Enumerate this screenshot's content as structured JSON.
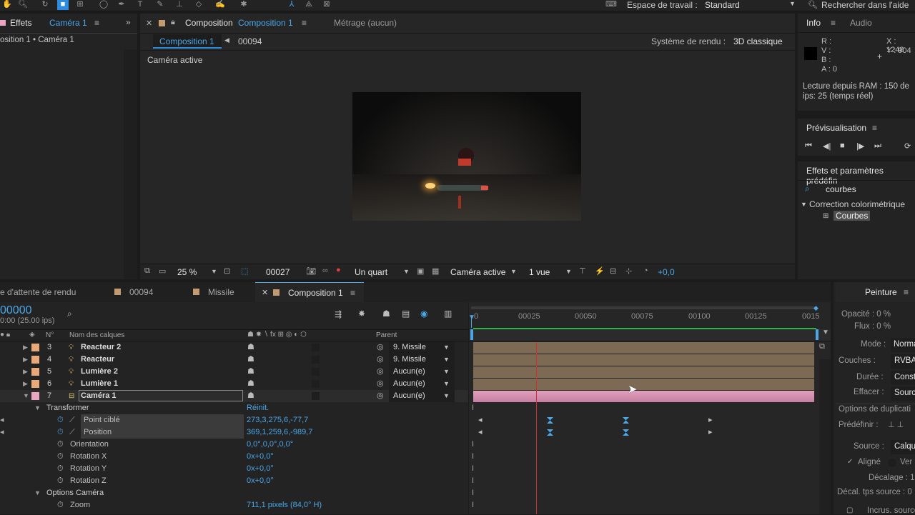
{
  "toolbar": {
    "workspace_label": "Espace de travail :",
    "workspace_value": "Standard",
    "help_search": "Rechercher dans l'aide"
  },
  "left_panel": {
    "tab_label": "Effets",
    "tab_target": "Caméra 1",
    "breadcrumb": "osition 1 • Caméra 1"
  },
  "comp_panel": {
    "tab_label": "Composition",
    "tab_name": "Composition 1",
    "footage_tab": "Métrage (aucun)",
    "sub_tab": "Composition 1",
    "frame_crumb": "00094",
    "renderer_label": "Système de rendu :",
    "renderer_value": "3D classique",
    "view_label": "Caméra active",
    "footer": {
      "zoom": "25 %",
      "timecode": "00027",
      "resolution": "Un quart",
      "camera": "Caméra active",
      "views": "1 vue",
      "exposure": "+0,0"
    }
  },
  "info_panel": {
    "tab_info": "Info",
    "tab_audio": "Audio",
    "r": "R :",
    "v": "V :",
    "b": "B :",
    "a": "A : 0",
    "x": "X : 1248",
    "y": "Y : 904",
    "ram_line1": "Lecture depuis RAM : 150 de",
    "ram_line2": "ips: 25 (temps réel)"
  },
  "preview_panel": {
    "title": "Prévisualisation"
  },
  "effects_panel": {
    "title": "Effets et paramètres prédéfin",
    "search_value": "courbes",
    "category": "Correction colorimétrique",
    "item": "Courbes"
  },
  "timeline_tabs": {
    "render_queue": "e d'attente de rendu",
    "tab_00094": "00094",
    "tab_missile": "Missile",
    "tab_comp": "Composition 1"
  },
  "timeline": {
    "timecode": "00000",
    "timecode_sub": "0:00 (25.00 ips)",
    "col_num": "N°",
    "col_name": "Nom des calques",
    "col_parent": "Parent",
    "ruler_ticks": [
      "0",
      "00025",
      "00050",
      "00075",
      "00100",
      "00125",
      "0015"
    ],
    "layers": [
      {
        "num": "3",
        "name": "Reacteur 2",
        "parent": "9. Missile",
        "color": "#e7a97a"
      },
      {
        "num": "4",
        "name": "Reacteur",
        "parent": "9. Missile",
        "color": "#e7a97a"
      },
      {
        "num": "5",
        "name": "Lumière 2",
        "parent": "Aucun(e)",
        "color": "#e7a97a"
      },
      {
        "num": "6",
        "name": "Lumière 1",
        "parent": "Aucun(e)",
        "color": "#e7a97a"
      },
      {
        "num": "7",
        "name": "Caméra 1",
        "parent": "Aucun(e)",
        "color": "#e9a6c2"
      }
    ],
    "props": {
      "transform": "Transformer",
      "reset": "Réinit.",
      "poi_label": "Point ciblé",
      "poi_value": "273,3,275,6,-77,7",
      "pos_label": "Position",
      "pos_value": "369,1,259,6,-989,7",
      "ori_label": "Orientation",
      "ori_value": "0,0°,0,0°,0,0°",
      "rx_label": "Rotation X",
      "rx_value": "0x+0,0°",
      "ry_label": "Rotation Y",
      "ry_value": "0x+0,0°",
      "rz_label": "Rotation Z",
      "rz_value": "0x+0,0°",
      "cam_options": "Options Caméra",
      "zoom_label": "Zoom",
      "zoom_value": "711,1 pixels (84,0° H)"
    }
  },
  "paint_panel": {
    "title": "Peinture",
    "opacity": "Opacité : 0 %",
    "flow": "Flux : 0 %",
    "mode_label": "Mode :",
    "mode_value": "Normal",
    "channels_label": "Couches :",
    "channels_value": "RVBA",
    "duration_label": "Durée :",
    "duration_value": "Constant",
    "erase_label": "Effacer :",
    "erase_value": "Source e",
    "dup_options": "Options de duplicati",
    "preset_label": "Prédéfinir :",
    "source_label": "Source :",
    "source_value": "Calque a",
    "aligned": "Aligné",
    "verr": "Ver",
    "offset": "Décalage : 1",
    "src_time": "Décal. tps source : 0",
    "inc_source": "Incrus. source"
  }
}
